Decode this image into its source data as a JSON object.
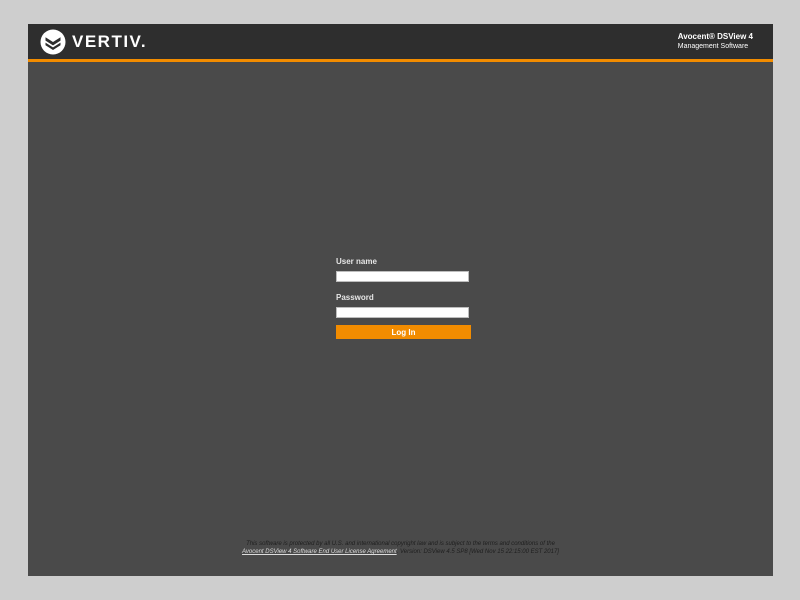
{
  "header": {
    "brand": "VERTIV.",
    "logo_icon": "vertiv-chevron-logo",
    "product_name": "Avocent® DSView 4",
    "product_subtitle": "Management Software"
  },
  "login": {
    "username_label": "User name",
    "username_value": "",
    "password_label": "Password",
    "password_value": "",
    "submit_label": "Log In"
  },
  "footer": {
    "line1": "This software is protected by all U.S. and international copyright law and is subject to the terms and conditions of the",
    "license_link": "Avocent DSView 4 Software End User License Agreement",
    "version_text": ". Version: DSView 4.5 SP8 [Wed Nov 15 22:15:00 EST 2017]"
  },
  "colors": {
    "accent": "#f28c00",
    "header_bg": "#2e2e2e",
    "page_bg": "#4a4a4a"
  }
}
